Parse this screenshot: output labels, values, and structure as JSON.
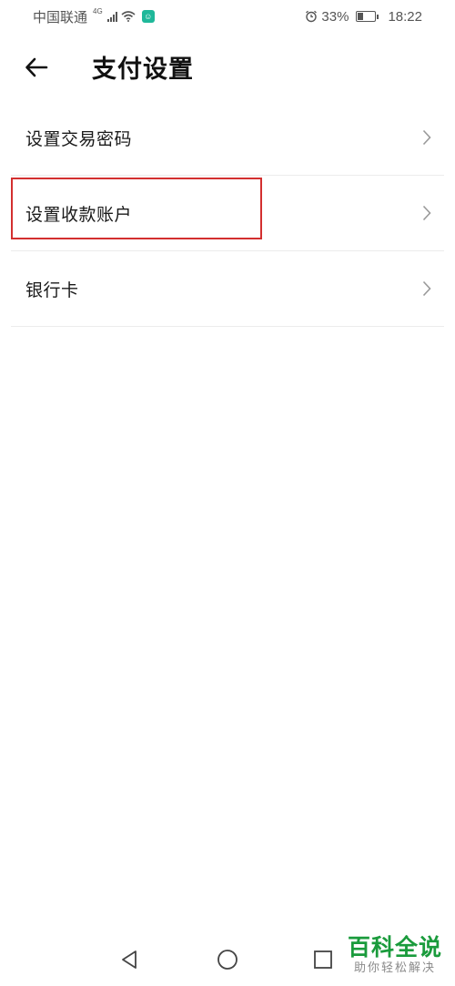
{
  "status_bar": {
    "carrier": "中国联通",
    "network": "4G",
    "battery_percent": "33%",
    "battery_level": 0.33,
    "time": "18:22"
  },
  "header": {
    "back_icon": "arrow-left-icon",
    "title": "支付设置"
  },
  "settings_list": {
    "items": [
      {
        "label": "设置交易密码",
        "icon": "chevron-right-icon"
      },
      {
        "label": "设置收款账户",
        "icon": "chevron-right-icon",
        "highlighted": true
      },
      {
        "label": "银行卡",
        "icon": "chevron-right-icon"
      }
    ],
    "highlight_color": "#d32f2f"
  },
  "nav_bar": {
    "back_icon": "triangle-back-icon",
    "home_icon": "circle-home-icon",
    "recent_icon": "square-recent-icon"
  },
  "watermark": {
    "main": "百科全说",
    "sub": "助你轻松解决",
    "color": "#1a9b3c"
  }
}
